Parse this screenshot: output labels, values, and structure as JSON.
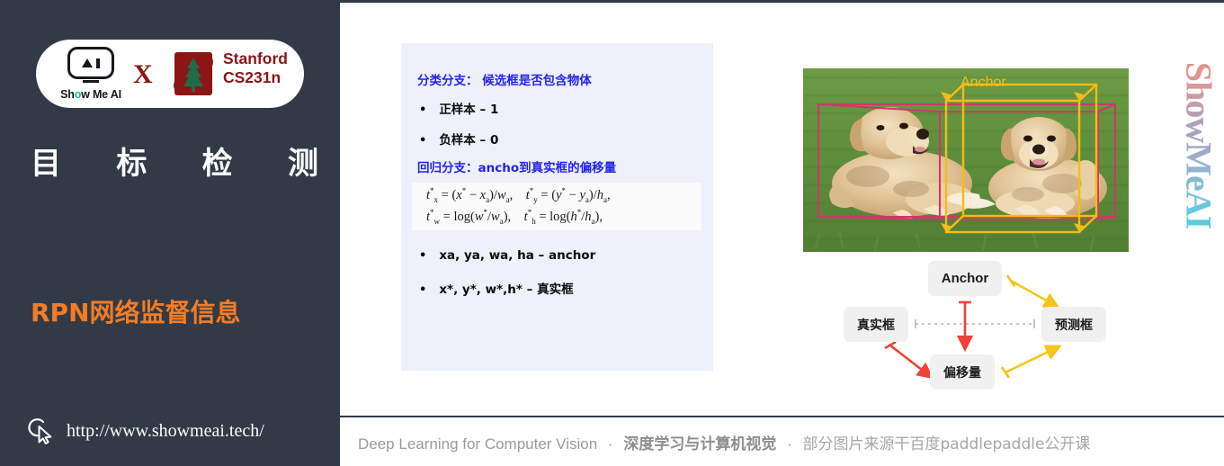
{
  "sidebar": {
    "brand": {
      "showmeai_word": "Show Me AI",
      "showmeai_o": "o",
      "cross": "X",
      "stanford_line1": "Stanford",
      "stanford_line2": "CS231n"
    },
    "title_chars": [
      "目",
      "标",
      "检",
      "测"
    ],
    "subtitle": "RPN网络监督信息",
    "url": "http://www.showmeai.tech/"
  },
  "slide": {
    "textbox": {
      "heading_classification": "分类分支： 候选框是否包含物体",
      "bullet_positive": "正样本 – 1",
      "bullet_negative": "负样本 – 0",
      "heading_regression": "回归分支：ancho到真实框的偏移量",
      "formula_line1": "t*x = (x* − xa)/wa,   t*y = (y* − ya)/ha,",
      "formula_line2": "t*w = log(w*/wa),   t*h = log(h*/ha),",
      "bullet_anchor": "xa, ya, wa, ha – anchor",
      "bullet_groundtruth": "x*, y*, w*,h* – 真实框"
    },
    "photo": {
      "anchor_label": "Anchor",
      "anchor_box_color": "#f5bc15",
      "gt_box_color": "#d3356b",
      "caption_alt": "两只金毛犬躺在草地上"
    },
    "diagram": {
      "box_anchor": "Anchor",
      "box_groundtruth": "真实框",
      "box_prediction": "预测框",
      "box_offset": "偏移量",
      "red_arrow_color": "#ef4136",
      "yellow_arrow_color": "#f5c518"
    },
    "watermark": "ShowMeAI"
  },
  "footer": {
    "english": "Deep Learning for Computer Vision",
    "sep1": "·",
    "chinese": "深度学习与计算机视觉",
    "sep2": "·",
    "source": "部分图片来源干百度paddlepaddle公开课"
  },
  "colors": {
    "sidebar_bg": "#313a46",
    "accent_orange": "#f57c25",
    "heading_blue": "#2323ee",
    "stanford_red": "#8c1515",
    "textbox_bg": "#eef0fb"
  }
}
